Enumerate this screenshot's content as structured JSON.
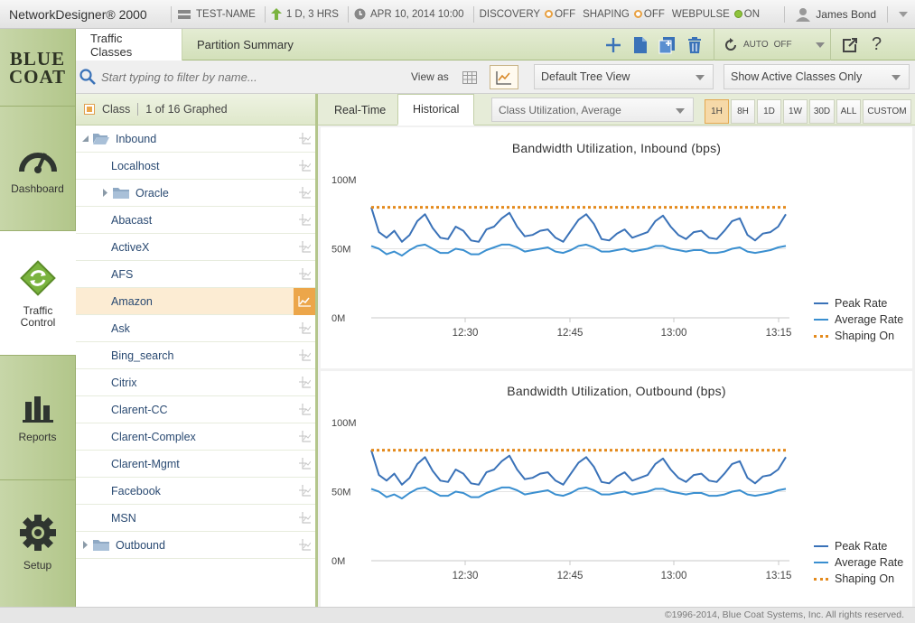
{
  "app": {
    "title": "NetworkDesigner® 2000"
  },
  "titlebar": {
    "device_name": "TEST-NAME",
    "uptime": "1 D, 3 HRS",
    "date": "APR 10, 2014 10:00",
    "discovery": {
      "label": "DISCOVERY",
      "status": "OFF"
    },
    "shaping": {
      "label": "SHAPING",
      "status": "OFF"
    },
    "webpulse": {
      "label": "WEBPULSE",
      "status": "ON"
    },
    "user": "James Bond"
  },
  "leftnav": {
    "logo_line1": "BLUE",
    "logo_line2": "COAT",
    "items": [
      {
        "label": "Dashboard"
      },
      {
        "label": "Traffic Control"
      },
      {
        "label": "Reports"
      },
      {
        "label": "Setup"
      }
    ]
  },
  "tabs": [
    {
      "label": "Traffic Classes"
    },
    {
      "label": "Partition Summary"
    }
  ],
  "toolbar": {
    "auto_label": "AUTO",
    "auto_state": "OFF"
  },
  "filter": {
    "placeholder": "Start typing to filter by name...",
    "view_as_label": "View as",
    "tree_view": "Default Tree View",
    "active_filter": "Show Active Classes Only"
  },
  "class_header": {
    "label": "Class",
    "graphed": "1 of 16 Graphed"
  },
  "classes": [
    {
      "name": "Inbound",
      "type": "folder-open",
      "level": 0
    },
    {
      "name": "Localhost",
      "type": "leaf",
      "level": 1
    },
    {
      "name": "Oracle",
      "type": "folder",
      "level": 1
    },
    {
      "name": "Abacast",
      "type": "leaf",
      "level": 1
    },
    {
      "name": "ActiveX",
      "type": "leaf",
      "level": 1
    },
    {
      "name": "AFS",
      "type": "leaf",
      "level": 1
    },
    {
      "name": "Amazon",
      "type": "leaf",
      "level": 1,
      "selected": true
    },
    {
      "name": "Ask",
      "type": "leaf",
      "level": 1
    },
    {
      "name": "Bing_search",
      "type": "leaf",
      "level": 1
    },
    {
      "name": "Citrix",
      "type": "leaf",
      "level": 1
    },
    {
      "name": "Clarent-CC",
      "type": "leaf",
      "level": 1
    },
    {
      "name": "Clarent-Complex",
      "type": "leaf",
      "level": 1
    },
    {
      "name": "Clarent-Mgmt",
      "type": "leaf",
      "level": 1
    },
    {
      "name": "Facebook",
      "type": "leaf",
      "level": 1
    },
    {
      "name": "MSN",
      "type": "leaf",
      "level": 1
    },
    {
      "name": "Outbound",
      "type": "folder",
      "level": 0
    }
  ],
  "chart_tabs": [
    {
      "label": "Real-Time"
    },
    {
      "label": "Historical"
    }
  ],
  "metric_select": "Class Utilization, Average",
  "ranges": [
    "1H",
    "8H",
    "1D",
    "1W",
    "30D",
    "ALL",
    "CUSTOM"
  ],
  "selected_range": "1H",
  "colors": {
    "peak": "#3a72b8",
    "average": "#3a8fd0",
    "shaping": "#e48a1c",
    "accent": "#eca64a"
  },
  "chart_data": [
    {
      "type": "line",
      "title": "Bandwidth Utilization, Inbound (bps)",
      "yticks": [
        "100M",
        "50M",
        "0M"
      ],
      "ylim": [
        0,
        100
      ],
      "xticks": [
        "12:30",
        "12:45",
        "13:00",
        "13:15"
      ],
      "legend": [
        "Peak Rate",
        "Average Rate",
        "Shaping On"
      ],
      "series": [
        {
          "name": "Peak Rate",
          "values": [
            80,
            62,
            58,
            63,
            55,
            60,
            70,
            75,
            65,
            58,
            57,
            66,
            63,
            56,
            55,
            64,
            66,
            72,
            76,
            66,
            59,
            60,
            63,
            64,
            58,
            55,
            63,
            71,
            75,
            68,
            57,
            56,
            61,
            64,
            58,
            60,
            62,
            70,
            74,
            66,
            60,
            57,
            62,
            63,
            58,
            57,
            63,
            70,
            72,
            60,
            56,
            61,
            62,
            66,
            75
          ]
        },
        {
          "name": "Average Rate",
          "values": [
            52,
            50,
            46,
            48,
            45,
            49,
            52,
            53,
            50,
            47,
            47,
            50,
            49,
            46,
            46,
            49,
            51,
            53,
            53,
            51,
            48,
            49,
            50,
            51,
            48,
            47,
            49,
            52,
            53,
            51,
            48,
            48,
            49,
            50,
            48,
            49,
            50,
            52,
            52,
            50,
            49,
            48,
            49,
            49,
            47,
            47,
            48,
            50,
            51,
            48,
            47,
            48,
            49,
            51,
            52
          ]
        },
        {
          "name": "Shaping On",
          "values": [
            80,
            80
          ]
        }
      ]
    },
    {
      "type": "line",
      "title": "Bandwidth Utilization, Outbound (bps)",
      "yticks": [
        "100M",
        "50M",
        "0M"
      ],
      "ylim": [
        0,
        100
      ],
      "xticks": [
        "12:30",
        "12:45",
        "13:00",
        "13:15"
      ],
      "legend": [
        "Peak Rate",
        "Average Rate",
        "Shaping On"
      ],
      "series": [
        {
          "name": "Peak Rate",
          "values": [
            80,
            62,
            58,
            63,
            55,
            60,
            70,
            75,
            65,
            58,
            57,
            66,
            63,
            56,
            55,
            64,
            66,
            72,
            76,
            66,
            59,
            60,
            63,
            64,
            58,
            55,
            63,
            71,
            75,
            68,
            57,
            56,
            61,
            64,
            58,
            60,
            62,
            70,
            74,
            66,
            60,
            57,
            62,
            63,
            58,
            57,
            63,
            70,
            72,
            60,
            56,
            61,
            62,
            66,
            75
          ]
        },
        {
          "name": "Average Rate",
          "values": [
            52,
            50,
            46,
            48,
            45,
            49,
            52,
            53,
            50,
            47,
            47,
            50,
            49,
            46,
            46,
            49,
            51,
            53,
            53,
            51,
            48,
            49,
            50,
            51,
            48,
            47,
            49,
            52,
            53,
            51,
            48,
            48,
            49,
            50,
            48,
            49,
            50,
            52,
            52,
            50,
            49,
            48,
            49,
            49,
            47,
            47,
            48,
            50,
            51,
            48,
            47,
            48,
            49,
            51,
            52
          ]
        },
        {
          "name": "Shaping On",
          "values": [
            80,
            80
          ]
        }
      ]
    }
  ],
  "footer": "©1996-2014, Blue Coat Systems, Inc. All rights reserved."
}
